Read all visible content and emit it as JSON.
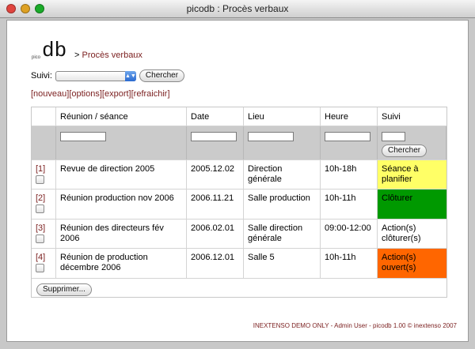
{
  "window": {
    "title": "picodb : Procès verbaux"
  },
  "brand": {
    "small": "pico",
    "big": "db",
    "separator": ">",
    "page": "Procès verbaux"
  },
  "filter": {
    "label": "Suivi:",
    "select_value": "",
    "search_button": "Chercher"
  },
  "actions": {
    "new": "[nouveau]",
    "options": "[options]",
    "export": "[export]",
    "refresh": "[refraichir]"
  },
  "table": {
    "headers": {
      "meeting": "Réunion / séance",
      "date": "Date",
      "place": "Lieu",
      "time": "Heure",
      "status": "Suivi"
    },
    "filter_button": "Chercher",
    "rows": [
      {
        "num": "[1]",
        "meeting": "Revue de direction 2005",
        "date": "2005.12.02",
        "place": "Direction générale",
        "time": "10h-18h",
        "status": "Séance à planifier",
        "status_color": "#ffff66"
      },
      {
        "num": "[2]",
        "meeting": "Réunion production nov 2006",
        "date": "2006.11.21",
        "place": "Salle production",
        "time": "10h-11h",
        "status": "Clôturer",
        "status_color": "#009900"
      },
      {
        "num": "[3]",
        "meeting": "Réunion des directeurs fév 2006",
        "date": "2006.02.01",
        "place": "Salle direction générale",
        "time": "09:00-12:00",
        "status": "Action(s) clôturer(s)",
        "status_color": "#ffffff"
      },
      {
        "num": "[4]",
        "meeting": "Réunion de production décembre 2006",
        "date": "2006.12.01",
        "place": "Salle 5",
        "time": "10h-11h",
        "status": "Action(s) ouvert(s)",
        "status_color": "#ff6600"
      }
    ],
    "delete_button": "Supprimer..."
  },
  "footer": "INEXTENSO DEMO ONLY - Admin User - picodb 1.00 © inextenso 2007",
  "colors": {
    "link": "#7a1e1e",
    "filter_bg": "#cbcbcb"
  }
}
